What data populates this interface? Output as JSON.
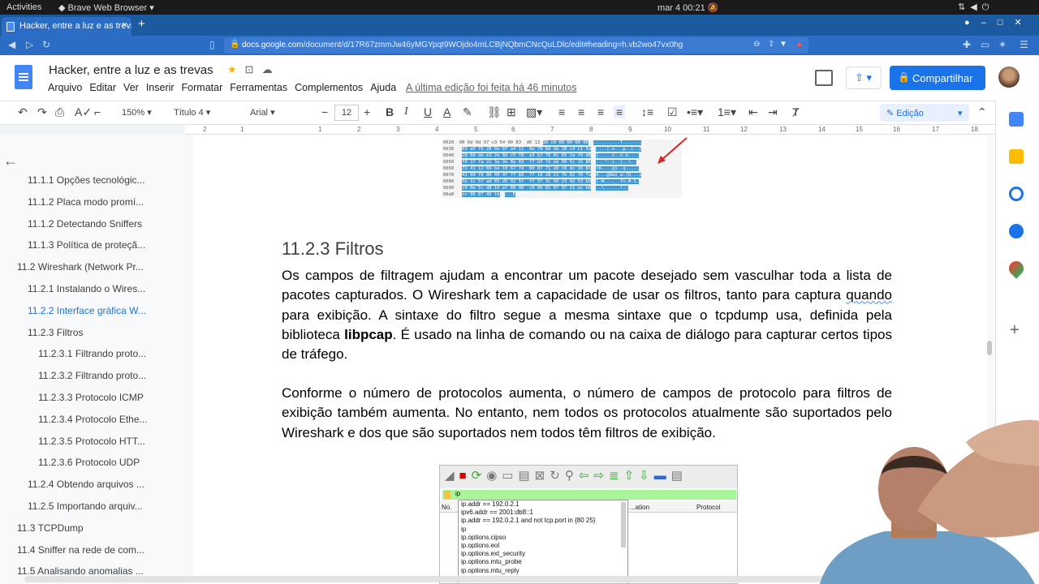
{
  "system_bar": {
    "activities": "Activities",
    "app_name": "Brave Web Browser",
    "clock": "mar 4  00:21"
  },
  "browser": {
    "tab_title": "Hacker, entre a luz e as trevas",
    "tab_close": "×",
    "new_tab": "+",
    "url_host": "docs.google.com",
    "url_path": "/document/d/17R67zmmJw46yMGYpqt9WOjdo4mLCBjNQbmCNcQuLDlc/edit#heading=h.vb2wo47vx0hg"
  },
  "docs_header": {
    "title": "Hacker, entre a luz e as trevas",
    "menu": [
      "Arquivo",
      "Editar",
      "Ver",
      "Inserir",
      "Formatar",
      "Ferramentas",
      "Complementos",
      "Ajuda"
    ],
    "last_edit": "A última edição foi feita há 46 minutos",
    "share_label": "Compartilhar"
  },
  "toolbar": {
    "zoom": "150%",
    "style": "Título 4",
    "font": "Arial",
    "font_size": "12",
    "mode": "Edição"
  },
  "ruler": {
    "ticks": [
      "2",
      "1",
      "1",
      "2",
      "3",
      "4",
      "5",
      "6",
      "7",
      "8",
      "9",
      "10",
      "11",
      "12",
      "13",
      "14",
      "15",
      "16",
      "17",
      "18"
    ]
  },
  "outline": {
    "items": [
      {
        "label": "11.1.1 Opções tecnológic...",
        "active": false
      },
      {
        "label": "11.1.2 Placa modo promí...",
        "active": false
      },
      {
        "label": "11.1.2 Detectando Sniffers",
        "active": false
      },
      {
        "label": "11.1.3 Política de proteçã...",
        "active": false
      },
      {
        "label": "11.2 Wireshark (Network Pr...",
        "active": false
      },
      {
        "label": "11.2.1 Instalando o Wires...",
        "active": false
      },
      {
        "label": "11.2.2 Interface gráfica W...",
        "active": true
      },
      {
        "label": "11.2.3 Filtros",
        "active": false
      },
      {
        "label": "11.2.3.1 Filtrando proto...",
        "active": false
      },
      {
        "label": "11.2.3.2 Filtrando proto...",
        "active": false
      },
      {
        "label": "11.2.3.3 Protocolo ICMP",
        "active": false
      },
      {
        "label": "11.2.3.4 Protocolo Ethe...",
        "active": false
      },
      {
        "label": "11.2.3.5 Protocolo HTT...",
        "active": false
      },
      {
        "label": "11.2.3.6 Protocolo UDP",
        "active": false
      },
      {
        "label": "11.2.4 Obtendo arquivos ...",
        "active": false
      },
      {
        "label": "11.2.5 Importando arquiv...",
        "active": false
      },
      {
        "label": "11.3 TCPDump",
        "active": false
      },
      {
        "label": "11.4 Sniffer na rede de com...",
        "active": false
      },
      {
        "label": "11.5 Analisando anomalias ...",
        "active": false
      }
    ]
  },
  "document": {
    "heading": "11.2.3 Filtros",
    "p1_a": "Os campos de filtragem ajudam a encontrar um pacote desejado sem vasculhar toda a lista de pacotes capturados. O Wireshark tem a capacidade de usar os filtros, tanto para captura ",
    "p1_squiggle": "quando",
    "p1_b": " para exibição. A sintaxe do filtro segue a mesma sintaxe que o tcpdump usa, definida pela biblioteca ",
    "p1_bold": "libpcap",
    "p1_c": ". É usado na linha de comando ou na caixa de diálogo para capturar certos tipos de tráfego.",
    "p2": "Conforme o número de protocolos aumenta, o número de campos de protocolo para filtros de exibição também aumenta. No entanto, nem todos os protocolos atualmente são suportados pelo Wireshark e dos que são suportados nem todos têm filtros de exibição."
  },
  "hexdump": {
    "rows": [
      {
        "off": "0020",
        "hex": "00 0d 0d 97 c3 54 00 83  d6 13",
        "sel": "38 c0 08 00 00 00"
      },
      {
        "off": "0030",
        "hex": "",
        "sel": "03 e0 f6 28 0e 6f a4 11  0e 70 0d de 28 c4 c1 5a"
      },
      {
        "off": "0040",
        "hex": "",
        "sel": "28 0d de e3 2e 8d c5 78  a3 b7 76 8c 65 1a f4 d8"
      },
      {
        "off": "0050",
        "hex": "",
        "sel": "f0 1f fa 22 3a 9e 8e 69  f7 b5 7d eb 99 5c 15 86"
      },
      {
        "off": "0060",
        "hex": "",
        "sel": "72 41 12 89 be 10 67 7d  0d 07 71 d0 c0 dc 16 81"
      },
      {
        "off": "0070",
        "hex": "",
        "sel": "41 00 f6 80 40 4f 77 69  77 16 28 51 fb 02 f6 7a"
      },
      {
        "off": "0080",
        "hex": "",
        "sel": "5b 1c 57 ad 05 d5 92 5f  ff 37 3c 90 23 92 53 b9"
      },
      {
        "off": "0090",
        "hex": "",
        "sel": "c0 0e 5c d8 16 ef 80 08  c9 06 01 07 97 21 ec b8"
      },
      {
        "off": "00a0",
        "hex": "",
        "sel": "cc 96 87 45 fe"
      }
    ],
    "ascii": [
      "..........T.......",
      "....(.o...p..(..Z",
      "(.....x..v.e....",
      "...\":.i..}..\\..",
      "rA....g}..q.....",
      "A...@Owi w.(Q...z",
      "[.W...._.7<.#.S.",
      "..\\......!..",
      "...E"
    ]
  },
  "wireshark_shot": {
    "filter_text": "ip",
    "col_no": "No.",
    "col_dest": "...ation",
    "col_proto": "Protocol",
    "suggestions": [
      "ip.addr == 192.0.2.1",
      "ipv6.addr == 2001:db8::1",
      "ip.addr == 192.0.2.1 and not tcp.port in {80 25}",
      "ip",
      "ip.options.cipso",
      "ip.options.eol",
      "ip.options.ext_security",
      "ip.options.mtu_probe",
      "ip.options.mtu_reply"
    ]
  },
  "colors": {
    "accent": "#1a73e8",
    "tab_blue": "#2b6cc4",
    "filter_green": "#a8f59a",
    "selection_blue": "#3d9bdc"
  }
}
